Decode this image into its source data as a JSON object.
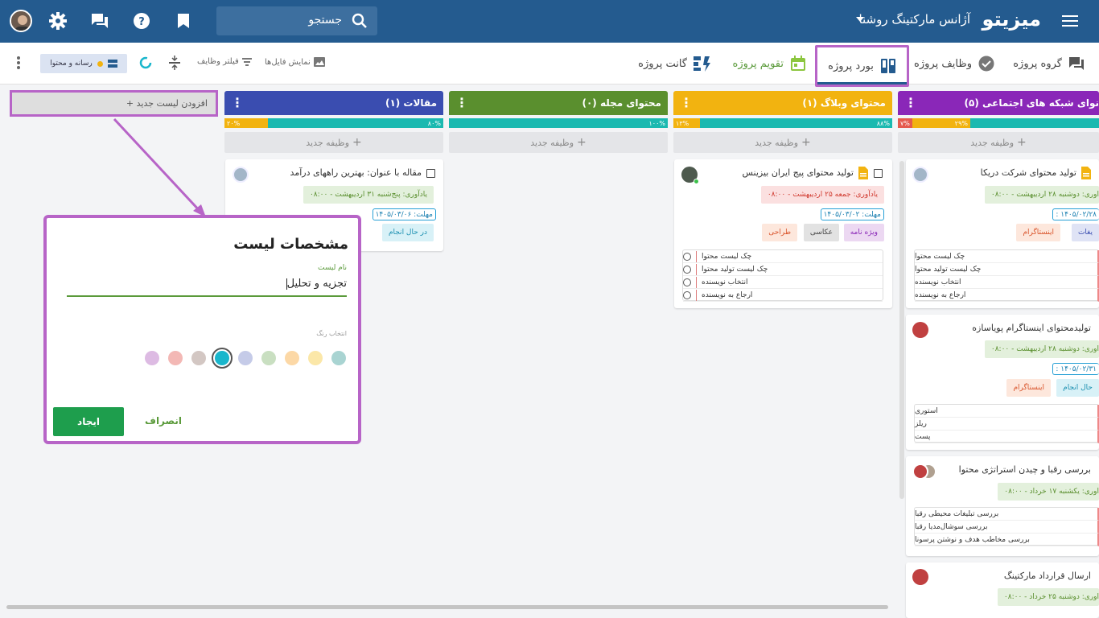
{
  "header": {
    "brand": "میزیتو",
    "agency": "آژانس مارکتینگ روشنا",
    "search_placeholder": "جستجو"
  },
  "toolbar": {
    "tabs": [
      {
        "label": "گروه پروژه"
      },
      {
        "label": "وظایف پروژه"
      },
      {
        "label": "بورد پروژه"
      },
      {
        "label": "تقویم پروژه"
      },
      {
        "label": "گانت پروژه"
      }
    ],
    "show_files": "نمایش فایل‌ها",
    "filter_tasks": "فیلتر وظایف",
    "filter_chip": "رسانه و محتوا"
  },
  "add_list": "+ افزودن لیست جدید",
  "new_task": "وظیفه جدید",
  "lists": [
    {
      "title": "مقالات (۱)",
      "color": "#3a4db0",
      "progress_a": "۸۰%",
      "progress_b": "۲۰%"
    },
    {
      "title": "محتوای مجله (۰)",
      "color": "#5a8f2e",
      "progress_a": "۱۰۰%"
    },
    {
      "title": "محتوای وبلاگ (۱)",
      "color": "#f2b310",
      "progress_a": "۸۸%",
      "progress_b": "۱۳%"
    },
    {
      "title": "نوای شبکه های اجتماعی (۵)",
      "color": "#8a27b8",
      "progress_a": "",
      "progress_b": "۲۹%",
      "progress_c": "۷%"
    }
  ],
  "cards": {
    "article": {
      "title": "مقاله با عنوان: بهترین راههای درآمد",
      "reminder": "یادآوری: پنج‌شنبه ۳۱ اردیبهشت - ۰۸:۰۰",
      "due": "مهلت: ۱۴۰۵/۰۳/۰۶",
      "tag": "در حال انجام"
    },
    "blog": {
      "title": "تولید محتوای پیج ایران بیزینس",
      "reminder": "یادآوری: جمعه ۲۵ اردیبهشت - ۰۸:۰۰",
      "due": "مهلت: ۱۴۰۵/۰۳/۰۲",
      "tags": [
        "ویژه نامه",
        "عکاسی",
        "طراحی"
      ],
      "checklist": [
        "چک لیست محتوا",
        "چک لیست تولید محتوا",
        "انتخاب نویسنده",
        "ارجاع به نویسنده"
      ]
    },
    "social1": {
      "title": "تولید محتوای شرکت دریکا",
      "reminder": "اوری: دوشنبه ۲۸ اردیبهشت - ۰۸:۰۰",
      "due": "۱۴۰۵/۰۲/۲۸ :",
      "tags": [
        "یغات",
        "اینستاگرام"
      ],
      "checklist": [
        "چک لیست محتوا",
        "چک لیست تولید محتوا",
        "انتخاب نویسنده",
        "ارجاع به نویسنده"
      ]
    },
    "social2": {
      "title": "تولیدمحتوای اینستاگرام پویاسازه",
      "reminder": "اوری: دوشنبه ۲۸ اردیبهشت - ۰۸:۰۰",
      "due": "۱۴۰۵/۰۲/۳۱ :",
      "tags": [
        "حال انجام",
        "اینستاگرام"
      ],
      "checklist": [
        "استوری",
        "ریلز",
        "پست"
      ]
    },
    "social3": {
      "title": "بررسی رقبا و چیدن استراتژی محتوا",
      "reminder": "اوری: یکشنبه ۱۷ خرداد - ۰۸:۰۰",
      "checklist": [
        "بررسی تبلیغات محیطی رقبا",
        "بررسی سوشال‌مدیا رقبا",
        "بررسی مخاطب هدف و نوشتن پرسونا"
      ]
    },
    "social4": {
      "title": "ارسال قرارداد مارکتینگ",
      "reminder": "اوری: دوشنبه ۲۵ خرداد - ۰۸:۰۰"
    }
  },
  "dialog": {
    "title": "مشخصات لیست",
    "name_label": "نام لیست",
    "name_value": "تجزیه و تحلیل",
    "color_label": "انتخاب رنگ",
    "swatches": [
      "#a9d4d2",
      "#fbe7a8",
      "#fcd8a6",
      "#c9dfc1",
      "#c5cbe8",
      "#19b6cc",
      "#d3c7c3",
      "#f3b8b5",
      "#ddbbe3"
    ],
    "create": "ایجاد",
    "cancel": "انصراف"
  }
}
